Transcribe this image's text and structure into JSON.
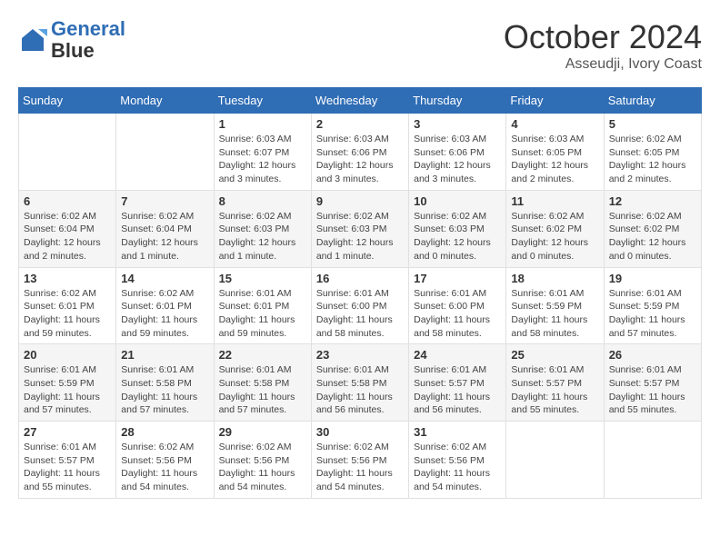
{
  "logo": {
    "line1": "General",
    "line2": "Blue"
  },
  "title": "October 2024",
  "location": "Asseudji, Ivory Coast",
  "days_of_week": [
    "Sunday",
    "Monday",
    "Tuesday",
    "Wednesday",
    "Thursday",
    "Friday",
    "Saturday"
  ],
  "weeks": [
    [
      {
        "day": "",
        "info": ""
      },
      {
        "day": "",
        "info": ""
      },
      {
        "day": "1",
        "info": "Sunrise: 6:03 AM\nSunset: 6:07 PM\nDaylight: 12 hours and 3 minutes."
      },
      {
        "day": "2",
        "info": "Sunrise: 6:03 AM\nSunset: 6:06 PM\nDaylight: 12 hours and 3 minutes."
      },
      {
        "day": "3",
        "info": "Sunrise: 6:03 AM\nSunset: 6:06 PM\nDaylight: 12 hours and 3 minutes."
      },
      {
        "day": "4",
        "info": "Sunrise: 6:03 AM\nSunset: 6:05 PM\nDaylight: 12 hours and 2 minutes."
      },
      {
        "day": "5",
        "info": "Sunrise: 6:02 AM\nSunset: 6:05 PM\nDaylight: 12 hours and 2 minutes."
      }
    ],
    [
      {
        "day": "6",
        "info": "Sunrise: 6:02 AM\nSunset: 6:04 PM\nDaylight: 12 hours and 2 minutes."
      },
      {
        "day": "7",
        "info": "Sunrise: 6:02 AM\nSunset: 6:04 PM\nDaylight: 12 hours and 1 minute."
      },
      {
        "day": "8",
        "info": "Sunrise: 6:02 AM\nSunset: 6:03 PM\nDaylight: 12 hours and 1 minute."
      },
      {
        "day": "9",
        "info": "Sunrise: 6:02 AM\nSunset: 6:03 PM\nDaylight: 12 hours and 1 minute."
      },
      {
        "day": "10",
        "info": "Sunrise: 6:02 AM\nSunset: 6:03 PM\nDaylight: 12 hours and 0 minutes."
      },
      {
        "day": "11",
        "info": "Sunrise: 6:02 AM\nSunset: 6:02 PM\nDaylight: 12 hours and 0 minutes."
      },
      {
        "day": "12",
        "info": "Sunrise: 6:02 AM\nSunset: 6:02 PM\nDaylight: 12 hours and 0 minutes."
      }
    ],
    [
      {
        "day": "13",
        "info": "Sunrise: 6:02 AM\nSunset: 6:01 PM\nDaylight: 11 hours and 59 minutes."
      },
      {
        "day": "14",
        "info": "Sunrise: 6:02 AM\nSunset: 6:01 PM\nDaylight: 11 hours and 59 minutes."
      },
      {
        "day": "15",
        "info": "Sunrise: 6:01 AM\nSunset: 6:01 PM\nDaylight: 11 hours and 59 minutes."
      },
      {
        "day": "16",
        "info": "Sunrise: 6:01 AM\nSunset: 6:00 PM\nDaylight: 11 hours and 58 minutes."
      },
      {
        "day": "17",
        "info": "Sunrise: 6:01 AM\nSunset: 6:00 PM\nDaylight: 11 hours and 58 minutes."
      },
      {
        "day": "18",
        "info": "Sunrise: 6:01 AM\nSunset: 5:59 PM\nDaylight: 11 hours and 58 minutes."
      },
      {
        "day": "19",
        "info": "Sunrise: 6:01 AM\nSunset: 5:59 PM\nDaylight: 11 hours and 57 minutes."
      }
    ],
    [
      {
        "day": "20",
        "info": "Sunrise: 6:01 AM\nSunset: 5:59 PM\nDaylight: 11 hours and 57 minutes."
      },
      {
        "day": "21",
        "info": "Sunrise: 6:01 AM\nSunset: 5:58 PM\nDaylight: 11 hours and 57 minutes."
      },
      {
        "day": "22",
        "info": "Sunrise: 6:01 AM\nSunset: 5:58 PM\nDaylight: 11 hours and 57 minutes."
      },
      {
        "day": "23",
        "info": "Sunrise: 6:01 AM\nSunset: 5:58 PM\nDaylight: 11 hours and 56 minutes."
      },
      {
        "day": "24",
        "info": "Sunrise: 6:01 AM\nSunset: 5:57 PM\nDaylight: 11 hours and 56 minutes."
      },
      {
        "day": "25",
        "info": "Sunrise: 6:01 AM\nSunset: 5:57 PM\nDaylight: 11 hours and 55 minutes."
      },
      {
        "day": "26",
        "info": "Sunrise: 6:01 AM\nSunset: 5:57 PM\nDaylight: 11 hours and 55 minutes."
      }
    ],
    [
      {
        "day": "27",
        "info": "Sunrise: 6:01 AM\nSunset: 5:57 PM\nDaylight: 11 hours and 55 minutes."
      },
      {
        "day": "28",
        "info": "Sunrise: 6:02 AM\nSunset: 5:56 PM\nDaylight: 11 hours and 54 minutes."
      },
      {
        "day": "29",
        "info": "Sunrise: 6:02 AM\nSunset: 5:56 PM\nDaylight: 11 hours and 54 minutes."
      },
      {
        "day": "30",
        "info": "Sunrise: 6:02 AM\nSunset: 5:56 PM\nDaylight: 11 hours and 54 minutes."
      },
      {
        "day": "31",
        "info": "Sunrise: 6:02 AM\nSunset: 5:56 PM\nDaylight: 11 hours and 54 minutes."
      },
      {
        "day": "",
        "info": ""
      },
      {
        "day": "",
        "info": ""
      }
    ]
  ]
}
